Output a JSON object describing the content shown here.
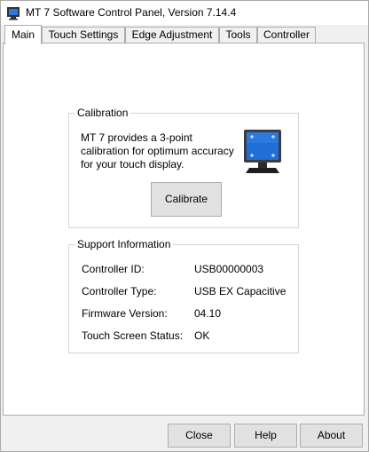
{
  "window": {
    "title": "MT 7 Software Control Panel, Version 7.14.4",
    "icon": "app-monitor-icon"
  },
  "tabs": [
    {
      "label": "Main",
      "active": true
    },
    {
      "label": "Touch Settings",
      "active": false
    },
    {
      "label": "Edge Adjustment",
      "active": false
    },
    {
      "label": "Tools",
      "active": false
    },
    {
      "label": "Controller",
      "active": false
    }
  ],
  "calibration": {
    "heading": "Calibration",
    "description": "MT 7 provides a 3-point calibration for optimum accuracy for your touch display.",
    "button_label": "Calibrate",
    "icon": "monitor-icon"
  },
  "support": {
    "heading": "Support Information",
    "rows": [
      {
        "label": "Controller ID:",
        "value": "USB00000003"
      },
      {
        "label": "Controller Type:",
        "value": "USB EX Capacitive"
      },
      {
        "label": "Firmware Version:",
        "value": "04.10"
      },
      {
        "label": "Touch Screen Status:",
        "value": "OK"
      }
    ]
  },
  "footer": {
    "close_label": "Close",
    "help_label": "Help",
    "about_label": "About"
  },
  "colors": {
    "window_bg": "#f0f0f0",
    "pane_bg": "#ffffff",
    "border": "#adadad",
    "monitor_screen": "#1f6fd6"
  }
}
